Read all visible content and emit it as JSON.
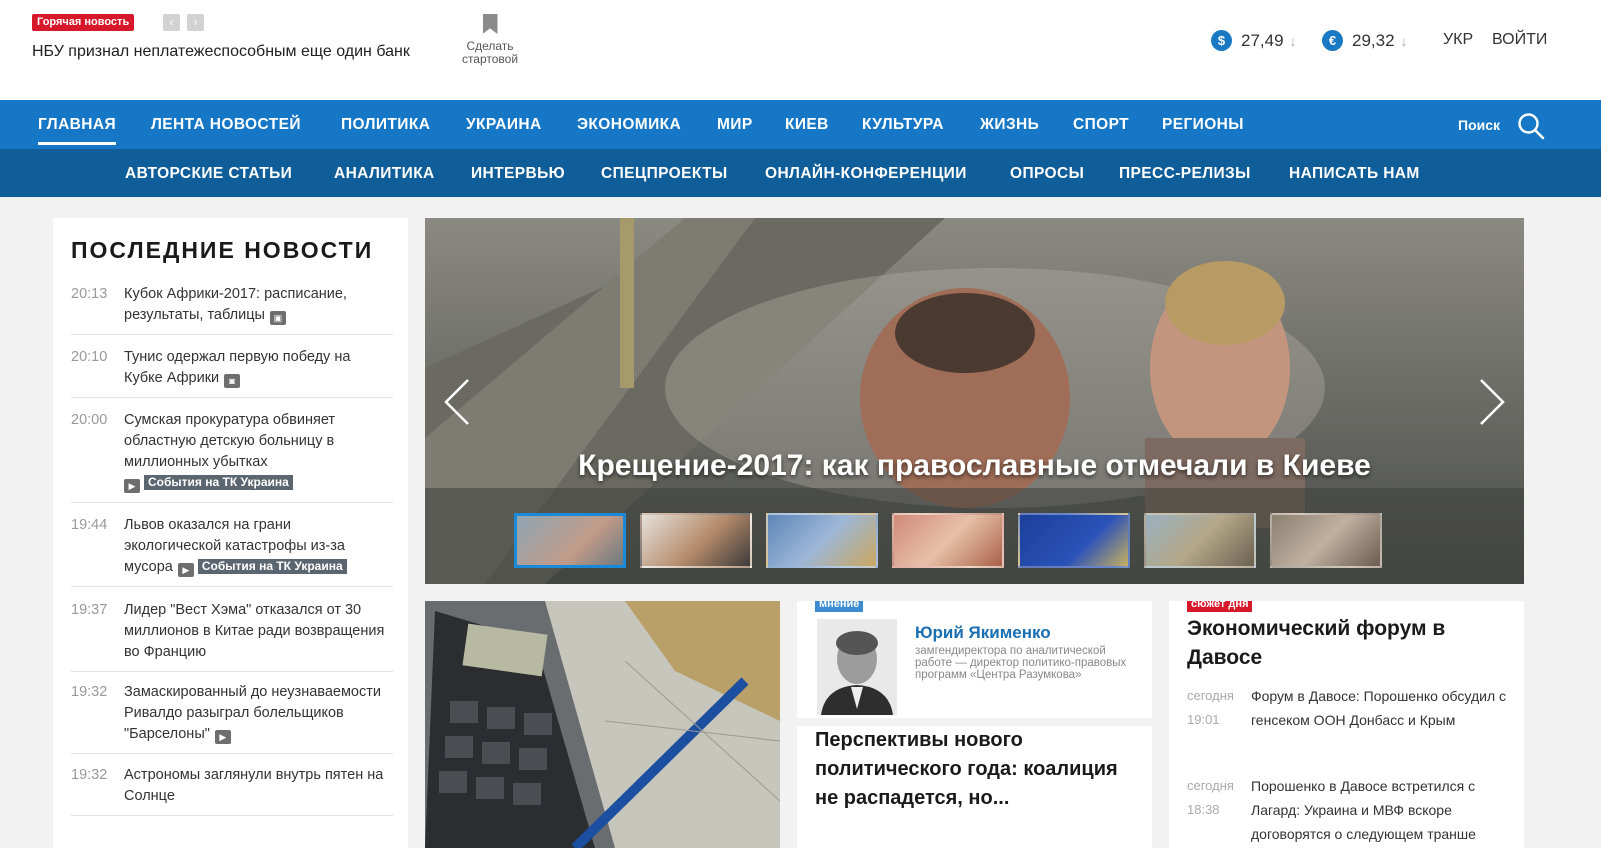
{
  "header": {
    "hot_badge": "Горячая новость",
    "hot_title": "НБУ признал неплатежеспособным еще один банк",
    "homepage_label": "Сделать стартовой",
    "currencies": [
      {
        "symbol": "$",
        "value": "27,49",
        "trend": "↓"
      },
      {
        "symbol": "€",
        "value": "29,32",
        "trend": "↓"
      }
    ],
    "lang": "УКР",
    "login": "ВОЙТИ"
  },
  "nav_main": [
    "ГЛАВНАЯ",
    "ЛЕНТА НОВОСТЕЙ",
    "ПОЛИТИКА",
    "УКРАИНА",
    "ЭКОНОМИКА",
    "МИР",
    "КИЕВ",
    "КУЛЬТУРА",
    "ЖИЗНЬ",
    "СПОРТ",
    "РЕГИОНЫ"
  ],
  "search_label": "Поиск",
  "nav_sub": [
    "АВТОРСКИЕ СТАТЬИ",
    "АНАЛИТИКА",
    "ИНТЕРВЬЮ",
    "СПЕЦПРОЕКТЫ",
    "ОНЛАЙН-КОНФЕРЕНЦИИ",
    "ОПРОСЫ",
    "ПРЕСС-РЕЛИЗЫ",
    "НАПИСАТЬ НАМ"
  ],
  "latest": {
    "title": "ПОСЛЕДНИЕ НОВОСТИ",
    "items": [
      {
        "time": "20:13",
        "text": "Кубок Африки-2017: расписание, результаты, таблицы"
      },
      {
        "time": "20:10",
        "text": "Тунис одержал первую победу на Кубке Африки"
      },
      {
        "time": "20:00",
        "text": "Сумская прокуратура обвиняет областную детскую больницу в миллионных убытках"
      },
      {
        "time": "19:44",
        "text": "Львов оказался на грани экологической катастрофы из-за мусора"
      },
      {
        "time": "19:37",
        "text": "Лидер \"Вест Хэма\" отказался от 30 миллионов в Китае ради возвращения во Францию"
      },
      {
        "time": "19:32",
        "text": "Замаскированный до неузнаваемости Ривалдо разыграл болельщиков \"Барселоны\""
      },
      {
        "time": "19:32",
        "text": "Астрономы заглянули внутрь пятен на Солнце"
      }
    ],
    "tag": "События на ТК Украина"
  },
  "hero": {
    "title": "Крещение-2017: как православные отмечали в Киеве"
  },
  "opinion": {
    "badge": "мнение",
    "name": "Юрий Якименко",
    "role": "замгендиректора по аналитической работе — директор политико-правовых программ «Центра Разумкова»",
    "headline": "Перспективы нового политического года: коалиция не распадется, но..."
  },
  "story": {
    "badge": "сюжет дня",
    "title": "Экономический форум в Давосе",
    "items": [
      {
        "day": "сегодня",
        "time": "19:01",
        "text": "Форум в Давосе: Порошенко обсудил с генсеком ООН Донбасс и Крым"
      },
      {
        "day": "сегодня",
        "time": "18:38",
        "text": "Порошенко в Давосе встретился с Лагард: Украина и МВФ вскоре договорятся о следующем транше"
      }
    ]
  }
}
